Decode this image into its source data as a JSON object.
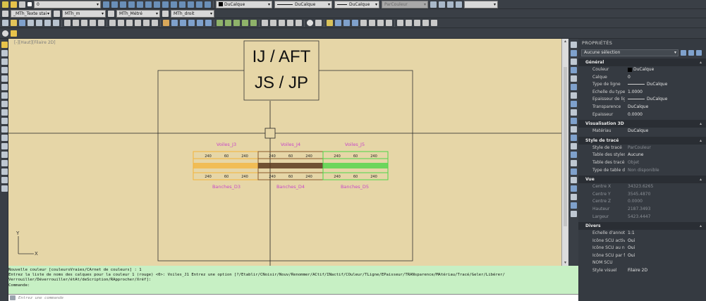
{
  "toolbar1": {
    "layer_combo": "0",
    "color_combo": "DuCalque",
    "linetype_combo": "DuCalque",
    "lineweight_combo": "DuCalque",
    "plotstyle_combo": "ParCouleur"
  },
  "toolbar2": {
    "text_style": "_MTh_Texte stai",
    "dim_style": "MTh_m",
    "table_style": "MTh_Métré",
    "multileader_style": "MTh_droit"
  },
  "viewport_label": "[-][Haut][Filaire 2D]",
  "drawing": {
    "title_line1": "IJ / AFT",
    "title_line2": "JS / JP",
    "top_labels": [
      "Voiles_J3",
      "Voiles_J4",
      "Voiles_J5"
    ],
    "bottom_labels": [
      "Banches_D3",
      "Banches_D4",
      "Banches_D5"
    ],
    "dim_values": [
      "240",
      "60",
      "240",
      "240",
      "60",
      "240",
      "240",
      "60",
      "240"
    ],
    "group_colors": [
      "#f4b43a",
      "#8b5a2b",
      "#4fd64a"
    ],
    "ucs_y": "Y",
    "ucs_x": "X"
  },
  "properties": {
    "title": "PROPRIÉTÉS",
    "selection": "Aucune sélection",
    "sections": [
      {
        "name": "Général",
        "rows": [
          {
            "k": "Couleur",
            "v": "DuCalque"
          },
          {
            "k": "Calque",
            "v": "0"
          },
          {
            "k": "Type de ligne",
            "v": "DuCalque"
          },
          {
            "k": "Echelle du type de li...",
            "v": "1.0000"
          },
          {
            "k": "Epaisseur de ligne",
            "v": "DuCalque"
          },
          {
            "k": "Transparence",
            "v": "DuCalque"
          },
          {
            "k": "Epaisseur",
            "v": "0.0000"
          }
        ]
      },
      {
        "name": "Visualisation 3D",
        "rows": [
          {
            "k": "Matériau",
            "v": "DuCalque"
          }
        ]
      },
      {
        "name": "Style de tracé",
        "rows": [
          {
            "k": "Style de tracé",
            "v": "ParCouleur"
          },
          {
            "k": "Table des styles de tr...",
            "v": "Aucune"
          },
          {
            "k": "Table des tracés atta...",
            "v": "Objet"
          },
          {
            "k": "Type de table de tracé",
            "v": "Non disponible"
          }
        ]
      },
      {
        "name": "Vue",
        "rows": [
          {
            "k": "Centre X",
            "v": "34323.6265"
          },
          {
            "k": "Centre Y",
            "v": "3545.4870"
          },
          {
            "k": "Centre Z",
            "v": "0.0000"
          },
          {
            "k": "Hauteur",
            "v": "2187.3493"
          },
          {
            "k": "Largeur",
            "v": "5423.4447"
          }
        ]
      },
      {
        "name": "Divers",
        "rows": [
          {
            "k": "Echelle d'annotation",
            "v": "1:1"
          },
          {
            "k": "Icône SCU active",
            "v": "Oui"
          },
          {
            "k": "Icône SCU au niveau...",
            "v": "Oui"
          },
          {
            "k": "Icône SCU par fenêtre",
            "v": "Oui"
          },
          {
            "k": "NOM SCU",
            "v": ""
          },
          {
            "k": "Style visuel",
            "v": "Filaire 2D"
          }
        ]
      }
    ]
  },
  "command": {
    "line1": "Nouvelle couleur [couleursVraies/CArnet de couleurs] : 1",
    "line2": "Entrez la liste de noms des calques pour la couleur 1 (rouge) <0>: Voiles_J1 Entrez une option [?/Etablir/CNoisir/Nouv/Renommer/ACtif/INactif/COuleur/TLigne/EPaisseur/TRANsparence/MAtériau/Tracé/Geler/Libérer/",
    "line3": "Verrouiller/Déverrouiller/étAt/deScription/RApprocher/Xréf]:",
    "line4": "Commande:",
    "placeholder": "Entrez une commande"
  }
}
